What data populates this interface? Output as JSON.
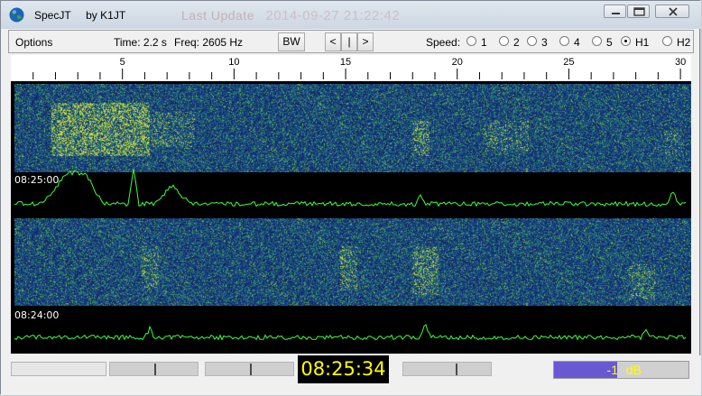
{
  "window": {
    "title": "SpecJT     by K1JT",
    "background_text_left": "Last Update",
    "background_text_right": "2014-09-27 21:22:42"
  },
  "menubar": {
    "options_label": "Options",
    "time_label": "Time:  2.2 s",
    "freq_label": "Freq:  2605 Hz",
    "bw_label": "BW",
    "nav_prev": "<",
    "nav_mid": "|",
    "nav_next": ">",
    "speed_label": "Speed:",
    "speeds": [
      {
        "label": "1",
        "selected": false
      },
      {
        "label": "2",
        "selected": false
      },
      {
        "label": "3",
        "selected": false
      },
      {
        "label": "4",
        "selected": false
      },
      {
        "label": "5",
        "selected": false
      },
      {
        "label": "H1",
        "selected": true
      },
      {
        "label": "H2",
        "selected": false
      }
    ]
  },
  "ruler": {
    "labels": [
      "5",
      "10",
      "15",
      "20",
      "25",
      "30"
    ]
  },
  "spectrogram": {
    "block1_time": "08:25:00",
    "block2_time": "08:24:00"
  },
  "statusbar": {
    "clock": "08:25:34",
    "db_value": "-1",
    "db_unit": "dB",
    "db_level_fraction": 0.47,
    "slider_positions": [
      0.5,
      0.5,
      0.6
    ]
  },
  "colors": {
    "accent_yellow": "#ffff00",
    "trace_green": "#3cff3c",
    "waterfall_blue": "#26336e",
    "db_fill": "#6a58d3"
  },
  "icons": [
    "globe-icon",
    "minimize-icon",
    "maximize-icon",
    "close-icon"
  ]
}
